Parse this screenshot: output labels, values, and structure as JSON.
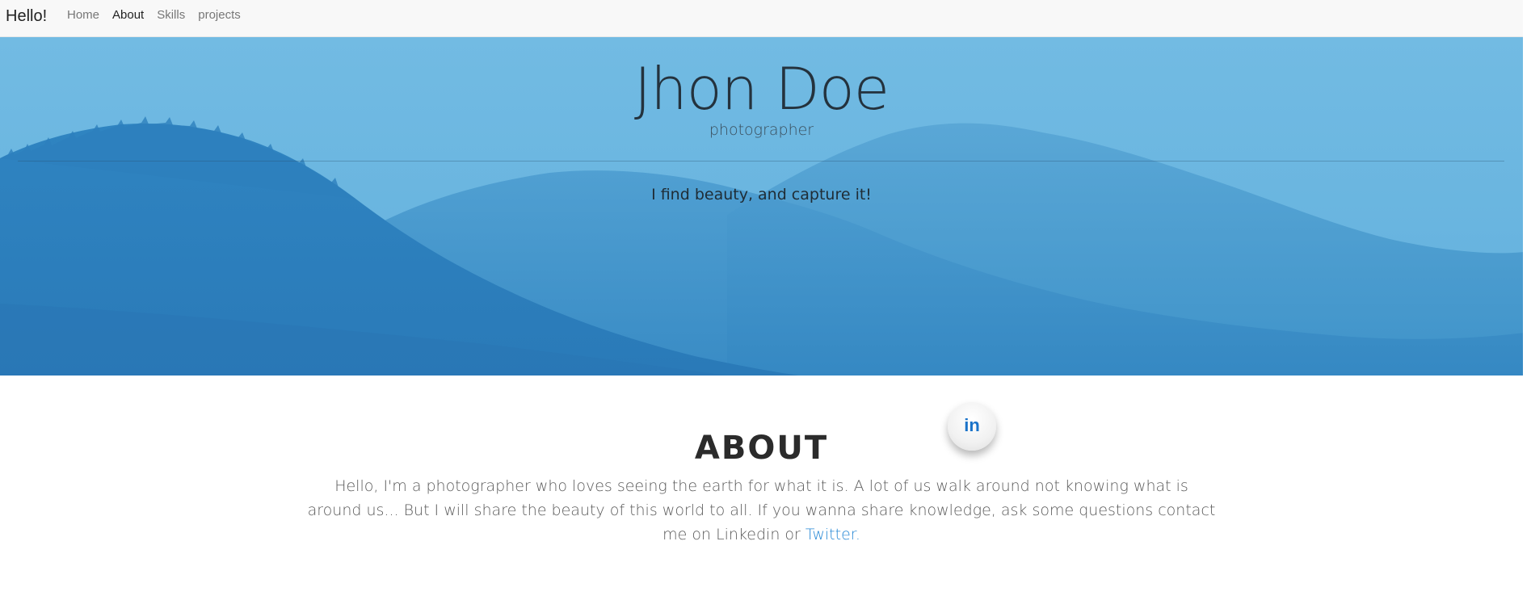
{
  "navbar": {
    "brand": "Hello!",
    "links": [
      {
        "label": "Home",
        "active": false
      },
      {
        "label": "About",
        "active": true
      },
      {
        "label": "Skills",
        "active": false
      },
      {
        "label": "projects",
        "active": false
      }
    ]
  },
  "hero": {
    "title": "Jhon Doe",
    "subtitle": "photographer",
    "tagline": "I find beauty, and capture it!"
  },
  "social": {
    "linkedin_glyph": "in",
    "icon": "linkedin-icon",
    "color": "#1a73c9"
  },
  "about": {
    "heading": "ABOUT",
    "text": "Hello, I'm a photographer who loves seeing the earth for what it is. A lot of us walk around not knowing what is around us... But I will share the beauty of this world to all. If you wanna share knowledge, ask some questions contact me on Linkedin or ",
    "twitter_link": "Twitter."
  },
  "colors": {
    "sky": "#6fb8e2",
    "hills_far": "#4fa0d3",
    "hills_near": "#2f7fbf",
    "link": "#2a8ad6"
  }
}
